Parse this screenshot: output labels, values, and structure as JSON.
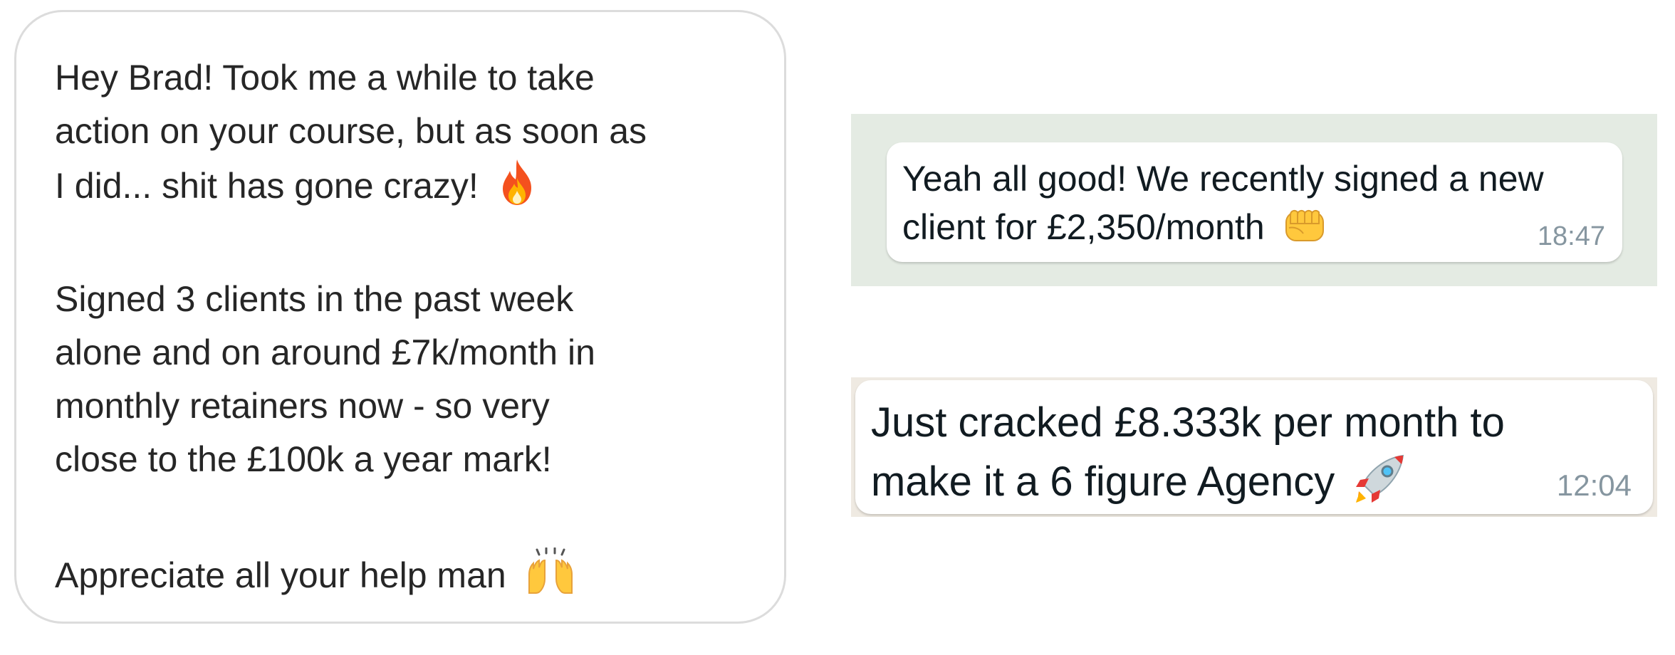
{
  "instagram_message": {
    "paragraph_1": {
      "line_1": "Hey Brad! Took me a while to take",
      "line_2": "action on your course, but as soon as",
      "line_3": "I did... shit has gone crazy!",
      "emoji": "fire-emoji"
    },
    "paragraph_2": {
      "line_1": "Signed 3 clients in the past week",
      "line_2": "alone and on around £7k/month in",
      "line_3": "monthly retainers now - so very",
      "line_4": "close to the £100k a year mark!"
    },
    "paragraph_3": {
      "line_1": "Appreciate all your help man",
      "emoji": "raising-hands-emoji"
    }
  },
  "whatsapp_messages": [
    {
      "line_1": "Yeah all good! We recently signed a new",
      "line_2": "client for £2,350/month",
      "emoji": "fist-bump-emoji",
      "time": "18:47"
    },
    {
      "line_1": "Just cracked £8.333k per month to",
      "line_2": "make it a 6 figure Agency",
      "emoji": "rocket-emoji",
      "time": "12:04"
    }
  ],
  "colors": {
    "text_primary": "#262626",
    "whatsapp_text": "#111b21",
    "timestamp": "#8696a0",
    "bubble_border": "#dcdcdc",
    "whatsapp_background": "#e5ddd5"
  }
}
